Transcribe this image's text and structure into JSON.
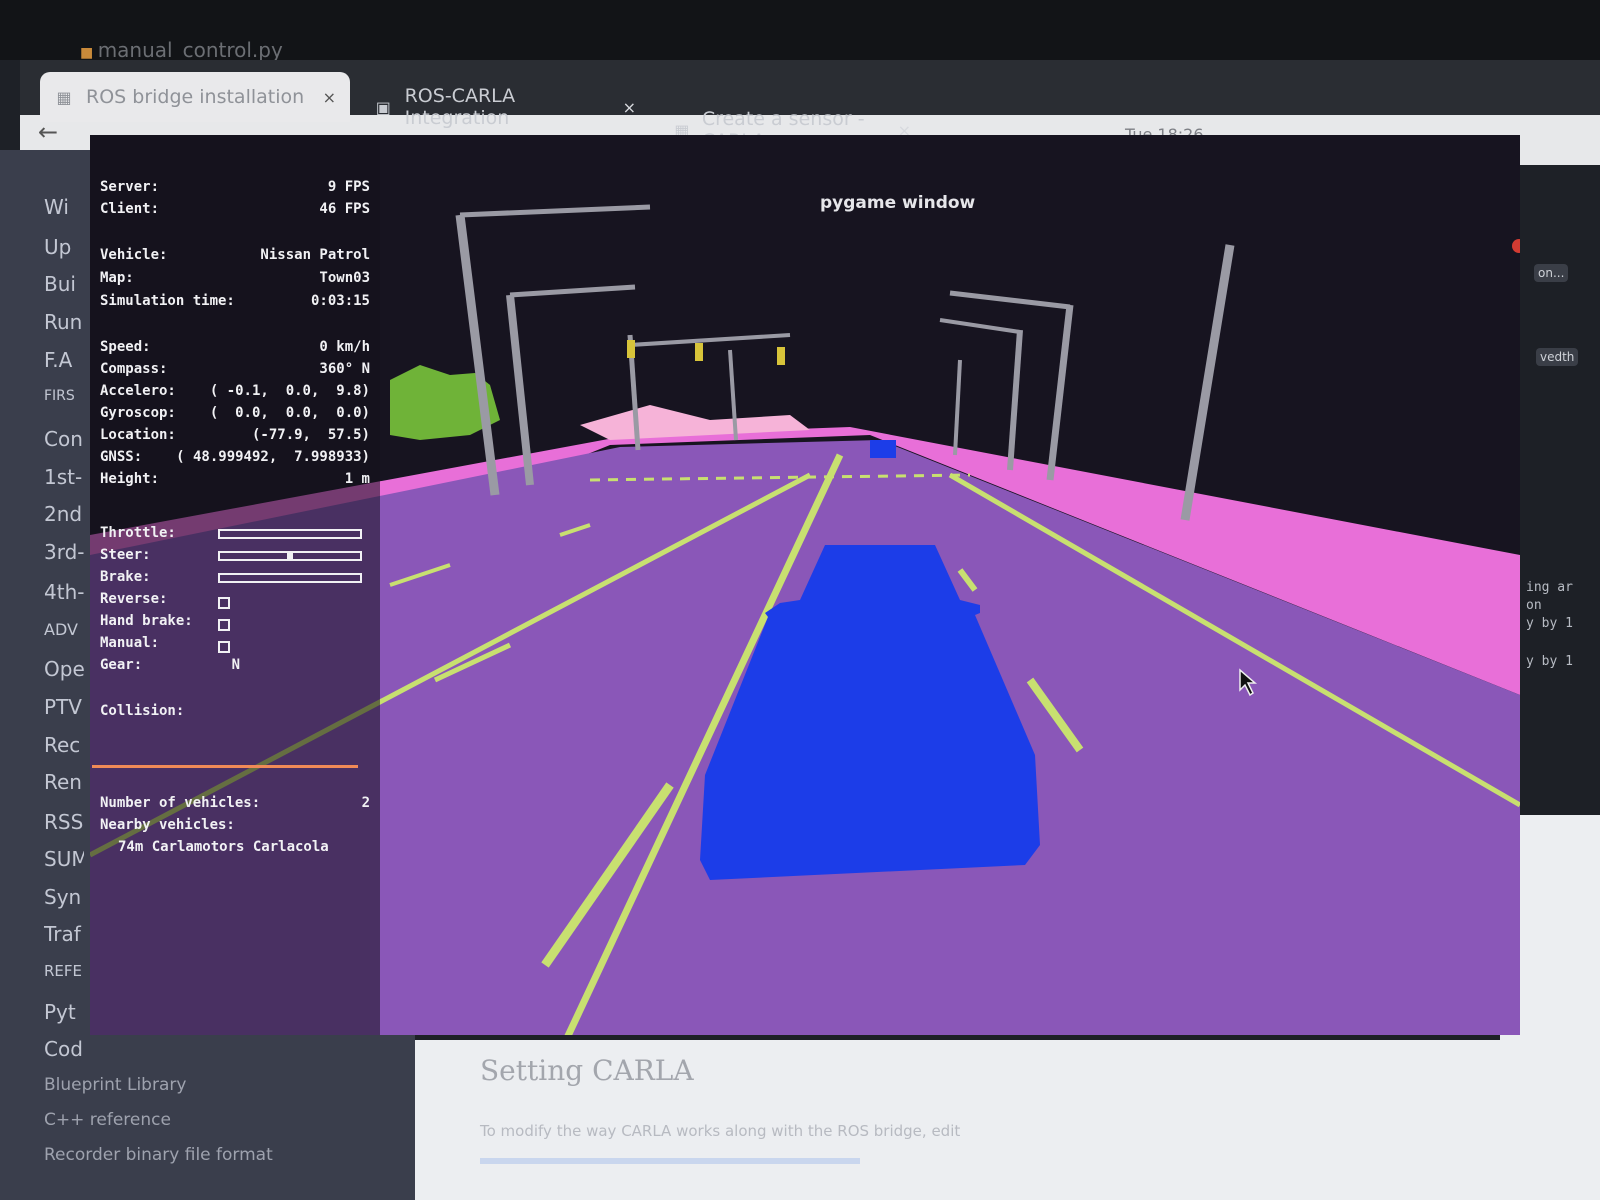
{
  "editor": {
    "file_tab": "manual_control.py"
  },
  "system": {
    "clock": "Tue 18:26"
  },
  "browser": {
    "tabs": [
      {
        "title": "ROS bridge installation",
        "close": "×"
      },
      {
        "title": "ROS-CARLA Integration",
        "close": "×"
      },
      {
        "title": "Create a sensor - CARLA",
        "close": "×"
      }
    ],
    "new_tab": "+",
    "back": "←"
  },
  "docs": {
    "nav": [
      "Wi",
      "Up",
      "Bui",
      "Run",
      "F.A",
      "FIRS",
      "Con",
      "1st-",
      "2nd",
      "3rd-",
      "4th-",
      "ADV",
      "Ope",
      "PTV",
      "Rec",
      "Ren",
      "RSS",
      "SUM",
      "Syn",
      "Traf",
      "REFE",
      "Pyt",
      "Cod",
      "Blueprint Library",
      "C++ reference",
      "Recorder binary file format"
    ],
    "heading": "Setting CARLA",
    "body": "To modify the way CARLA works along with the ROS bridge, edit"
  },
  "terminal": {
    "badge": "on...",
    "badge2": "vedth",
    "lines": [
      "ing ar",
      "on",
      "y by 1",
      "y by 1"
    ]
  },
  "pygame": {
    "title": "pygame window",
    "hud": {
      "server_label": "Server:",
      "server_value": "9 FPS",
      "client_label": "Client:",
      "client_value": "46 FPS",
      "vehicle_label": "Vehicle:",
      "vehicle_value": "Nissan Patrol",
      "map_label": "Map:",
      "map_value": "Town03",
      "simtime_label": "Simulation time:",
      "simtime_value": "0:03:15",
      "speed_label": "Speed:",
      "speed_value": "0 km/h",
      "compass_label": "Compass:",
      "compass_value": "360° N",
      "accelero_label": "Accelero:",
      "accelero_value": "( -0.1,  0.0,  9.8)",
      "gyroscop_label": "Gyroscop:",
      "gyroscop_value": "(  0.0,  0.0,  0.0)",
      "location_label": "Location:",
      "location_value": "(-77.9,  57.5)",
      "gnss_label": "GNSS:",
      "gnss_value": "( 48.999492,  7.998933)",
      "height_label": "Height:",
      "height_value": "1 m",
      "throttle_label": "Throttle:",
      "throttle": 0.0,
      "steer_label": "Steer:",
      "steer": 0.0,
      "brake_label": "Brake:",
      "brake": 0.0,
      "reverse_label": "Reverse:",
      "handbrake_label": "Hand brake:",
      "manual_label": "Manual:",
      "gear_label": "Gear:",
      "gear_value": "N",
      "collision_label": "Collision:",
      "num_vehicles_label": "Number of vehicles:",
      "num_vehicles_value": "2",
      "nearby_label": "Nearby vehicles:",
      "nearby_item": "74m Carlamotors Carlacola"
    }
  },
  "colors": {
    "sky": "#171420",
    "road": "#8a57b8",
    "sidewalk": "#e86fd8",
    "vegetation": "#6fb338",
    "poles": "#9a9aa4",
    "lane_marking": "#c8e070",
    "vehicle": "#1c3de8",
    "traffic_light": "#d8c43a"
  }
}
